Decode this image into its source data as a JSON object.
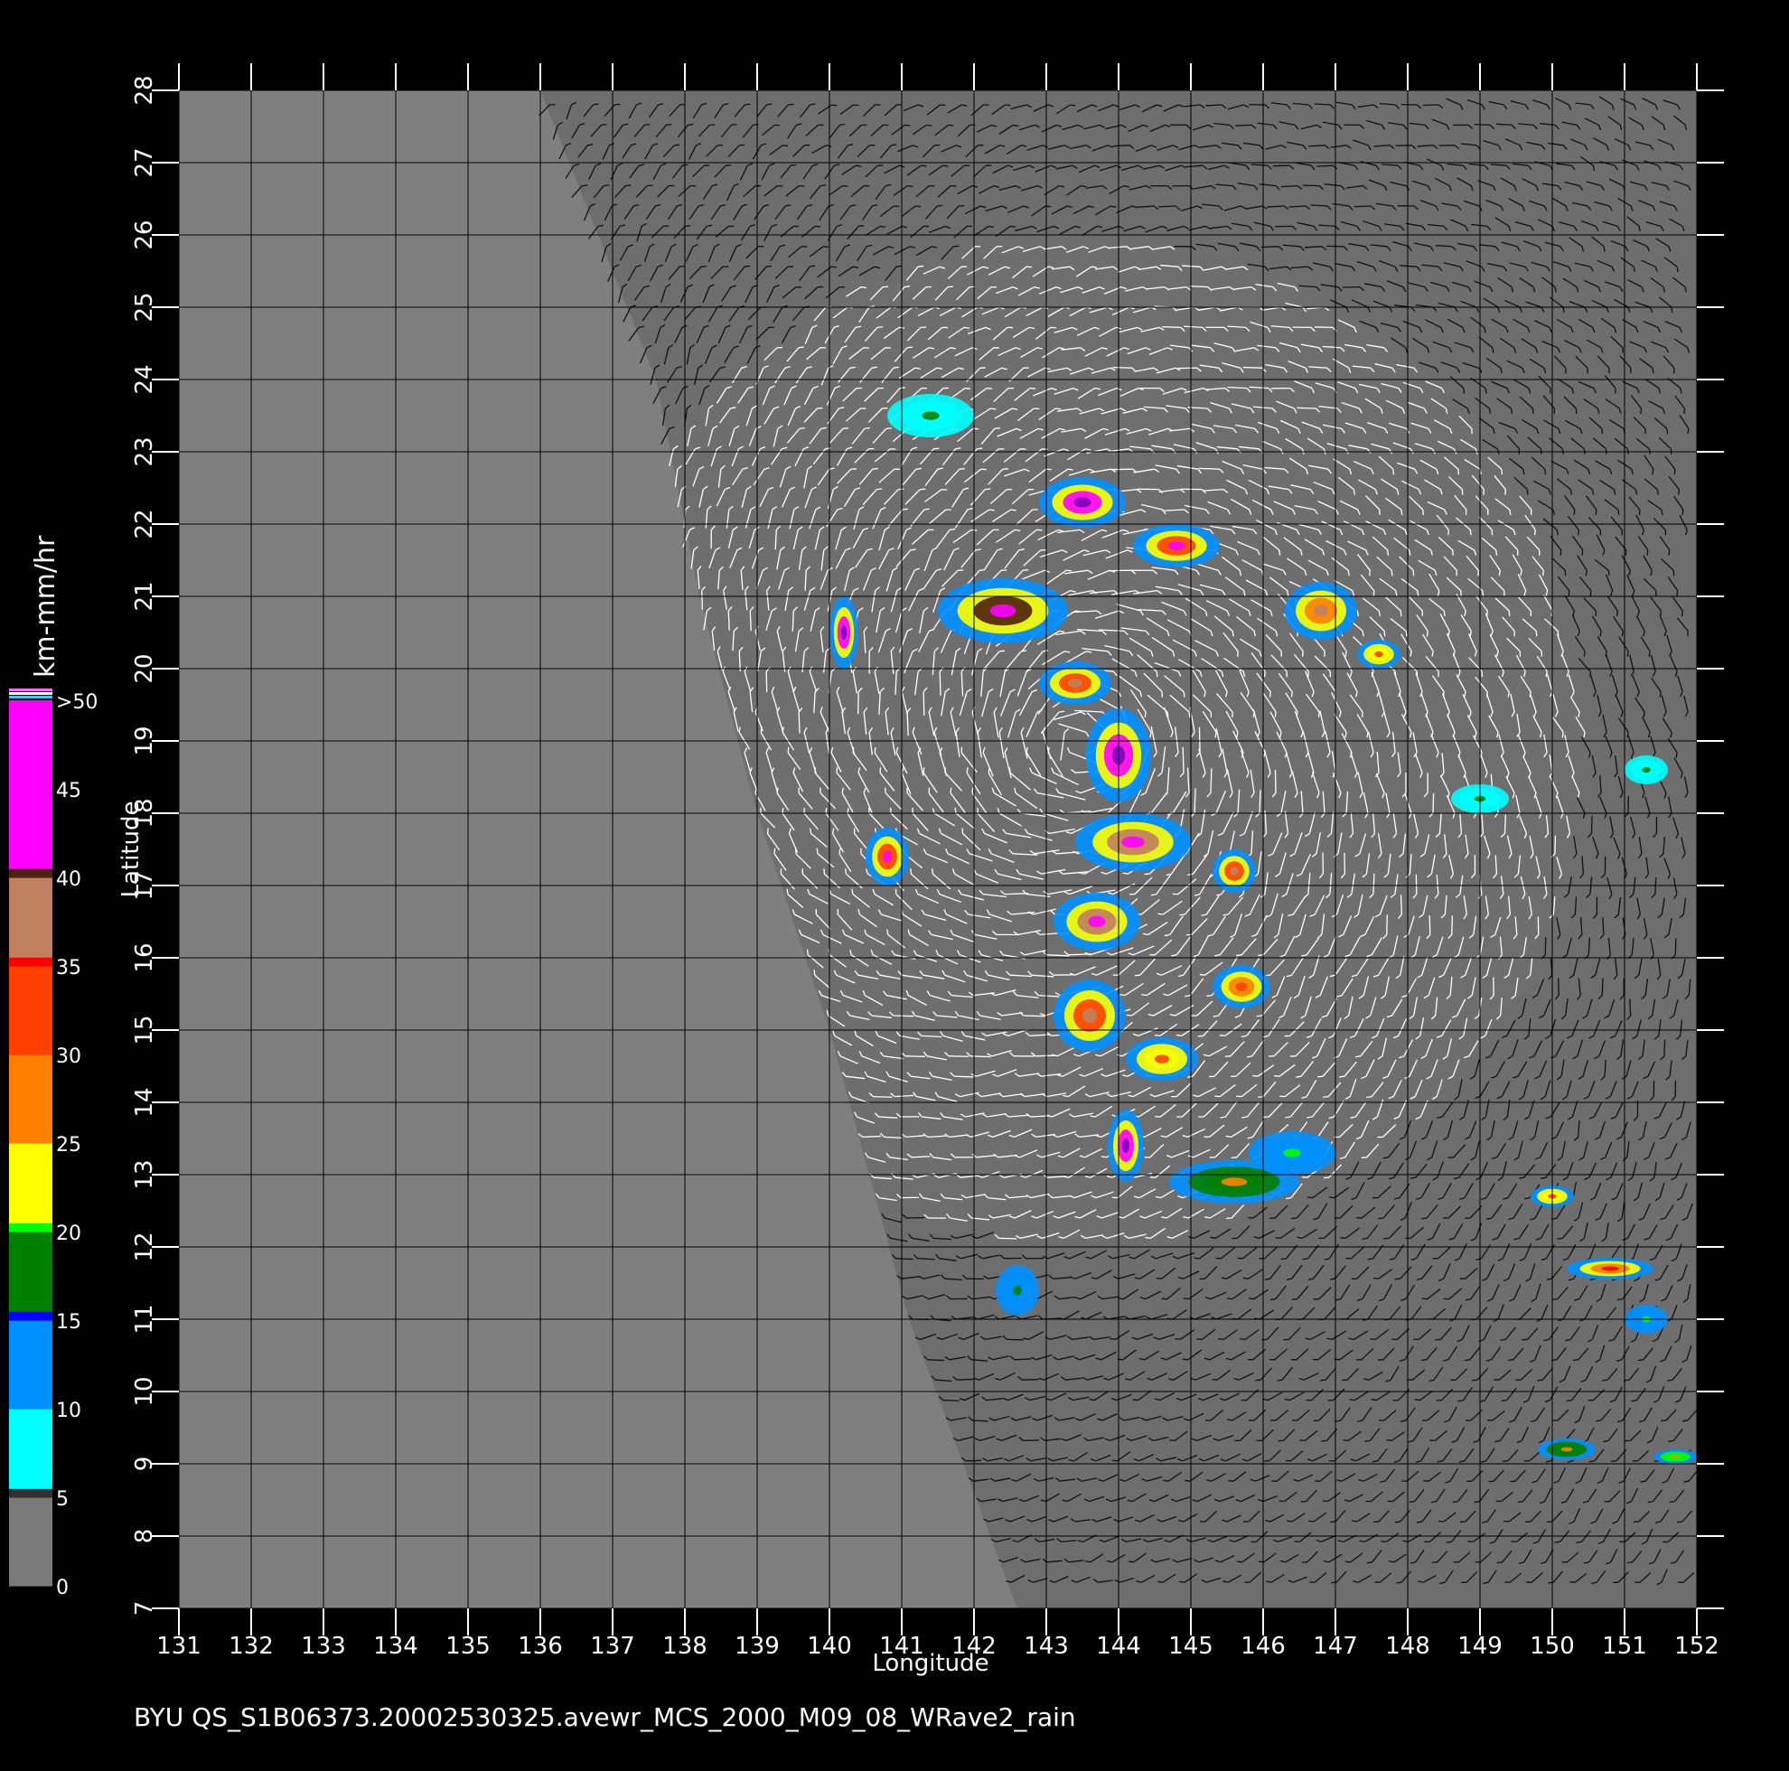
{
  "footer": {
    "caption": "BYU  QS_S1B06373.20002530325.avewr_MCS_2000_M09_08_WRave2_rain"
  },
  "axes": {
    "xlabel": "Longitude",
    "ylabel": "Latitude",
    "xlim": [
      131,
      152
    ],
    "ylim": [
      7,
      28
    ],
    "xticks": [
      "131",
      "132",
      "133",
      "134",
      "135",
      "136",
      "137",
      "138",
      "139",
      "140",
      "141",
      "142",
      "143",
      "144",
      "145",
      "146",
      "147",
      "148",
      "149",
      "150",
      "151",
      "152"
    ],
    "yticks": [
      "7",
      "8",
      "9",
      "10",
      "11",
      "12",
      "13",
      "14",
      "15",
      "16",
      "17",
      "18",
      "19",
      "20",
      "21",
      "22",
      "23",
      "24",
      "25",
      "26",
      "27",
      "28"
    ],
    "grid": true
  },
  "colorbar": {
    "title": "km-mm/hr",
    "tick_labels": [
      "0",
      "5",
      "10",
      "15",
      "20",
      "25",
      "30",
      "35",
      "40",
      "45",
      ">50"
    ],
    "tick_values": [
      0,
      5,
      10,
      15,
      20,
      25,
      30,
      35,
      40,
      45,
      50
    ],
    "stops": [
      {
        "v": 0,
        "color": "#7a7a7a"
      },
      {
        "v": 5,
        "color": "#303030"
      },
      {
        "v": 5.01,
        "color": "#00ffff"
      },
      {
        "v": 10,
        "color": "#0090ff"
      },
      {
        "v": 15,
        "color": "#0000ff"
      },
      {
        "v": 15.01,
        "color": "#008000"
      },
      {
        "v": 20,
        "color": "#00ff00"
      },
      {
        "v": 20.01,
        "color": "#ffff00"
      },
      {
        "v": 25,
        "color": "#ff8000"
      },
      {
        "v": 30,
        "color": "#ff4000"
      },
      {
        "v": 35,
        "color": "#ff0000"
      },
      {
        "v": 35.01,
        "color": "#c08060"
      },
      {
        "v": 40,
        "color": "#502010"
      },
      {
        "v": 40.01,
        "color": "#ff00ff"
      },
      {
        "v": 50,
        "color": "#8000c0"
      }
    ]
  },
  "map_colors": {
    "ocean": "#7f7f7f",
    "swath": "#6e6e6e",
    "grid": "#000000",
    "wind_white": "#ffffff",
    "wind_black": "#111111"
  },
  "rain_cells": [
    {
      "lon": 143.5,
      "lat": 22.3,
      "rx": 0.6,
      "ry": 0.35,
      "level": 42
    },
    {
      "lon": 144.8,
      "lat": 21.7,
      "rx": 0.6,
      "ry": 0.3,
      "level": 33
    },
    {
      "lon": 142.4,
      "lat": 20.8,
      "rx": 0.9,
      "ry": 0.45,
      "level": 40
    },
    {
      "lon": 143.4,
      "lat": 19.8,
      "rx": 0.5,
      "ry": 0.3,
      "level": 30
    },
    {
      "lon": 144.0,
      "lat": 18.8,
      "rx": 0.45,
      "ry": 0.65,
      "level": 48
    },
    {
      "lon": 144.2,
      "lat": 17.6,
      "rx": 0.8,
      "ry": 0.4,
      "level": 38
    },
    {
      "lon": 143.7,
      "lat": 16.5,
      "rx": 0.6,
      "ry": 0.4,
      "level": 36
    },
    {
      "lon": 143.6,
      "lat": 15.2,
      "rx": 0.5,
      "ry": 0.5,
      "level": 30
    },
    {
      "lon": 145.7,
      "lat": 15.6,
      "rx": 0.4,
      "ry": 0.3,
      "level": 25
    },
    {
      "lon": 144.6,
      "lat": 14.6,
      "rx": 0.5,
      "ry": 0.3,
      "level": 22
    },
    {
      "lon": 144.1,
      "lat": 13.4,
      "rx": 0.25,
      "ry": 0.5,
      "level": 44
    },
    {
      "lon": 145.6,
      "lat": 12.9,
      "rx": 0.9,
      "ry": 0.3,
      "level": 18
    },
    {
      "lon": 146.4,
      "lat": 13.3,
      "rx": 0.6,
      "ry": 0.3,
      "level": 12
    },
    {
      "lon": 142.6,
      "lat": 11.4,
      "rx": 0.3,
      "ry": 0.35,
      "level": 10
    },
    {
      "lon": 140.8,
      "lat": 17.4,
      "rx": 0.3,
      "ry": 0.4,
      "level": 34
    },
    {
      "lon": 140.2,
      "lat": 20.5,
      "rx": 0.2,
      "ry": 0.5,
      "level": 42
    },
    {
      "lon": 141.4,
      "lat": 23.5,
      "rx": 0.6,
      "ry": 0.3,
      "level": 9
    },
    {
      "lon": 146.8,
      "lat": 20.8,
      "rx": 0.5,
      "ry": 0.4,
      "level": 28
    },
    {
      "lon": 147.6,
      "lat": 20.2,
      "rx": 0.3,
      "ry": 0.2,
      "level": 24
    },
    {
      "lon": 150.8,
      "lat": 11.7,
      "rx": 0.6,
      "ry": 0.15,
      "level": 27
    },
    {
      "lon": 150.0,
      "lat": 12.7,
      "rx": 0.3,
      "ry": 0.15,
      "level": 22
    },
    {
      "lon": 150.2,
      "lat": 9.2,
      "rx": 0.4,
      "ry": 0.15,
      "level": 18
    },
    {
      "lon": 151.3,
      "lat": 11.0,
      "rx": 0.3,
      "ry": 0.2,
      "level": 12
    },
    {
      "lon": 151.3,
      "lat": 18.6,
      "rx": 0.3,
      "ry": 0.2,
      "level": 8
    },
    {
      "lon": 149.0,
      "lat": 18.2,
      "rx": 0.4,
      "ry": 0.2,
      "level": 8
    },
    {
      "lon": 151.7,
      "lat": 9.1,
      "rx": 0.3,
      "ry": 0.1,
      "level": 20
    },
    {
      "lon": 145.6,
      "lat": 17.2,
      "rx": 0.3,
      "ry": 0.3,
      "level": 30
    }
  ]
}
